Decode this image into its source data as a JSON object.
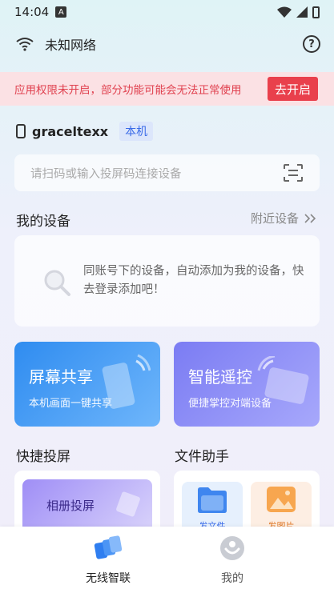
{
  "status_bar": {
    "time": "14:04",
    "notification_letter": "A"
  },
  "network": {
    "label": "未知网络"
  },
  "permission_banner": {
    "text": "应用权限未开启，部分功能可能会无法正常使用",
    "button": "去开启"
  },
  "device": {
    "name": "graceltexx",
    "badge": "本机"
  },
  "search": {
    "placeholder": "请扫码或输入投屏码连接设备"
  },
  "my_devices": {
    "title": "我的设备",
    "nearby_label": "附近设备",
    "empty_message": "同账号下的设备，自动添加为我的设备，快去登录添加吧！"
  },
  "features": [
    {
      "title": "屏幕共享",
      "subtitle": "本机画面一键共享"
    },
    {
      "title": "智能遥控",
      "subtitle": "便捷掌控对端设备"
    }
  ],
  "quick_cast": {
    "title": "快捷投屏",
    "album_button": "相册投屏"
  },
  "file_assistant": {
    "title": "文件助手",
    "send_file": "发文件",
    "send_image": "发图片"
  },
  "bottom_nav": {
    "home": "无线智联",
    "mine": "我的"
  },
  "colors": {
    "accent": "#3a6be8",
    "danger": "#e9404c",
    "banner_bg": "#fbe1e4"
  }
}
